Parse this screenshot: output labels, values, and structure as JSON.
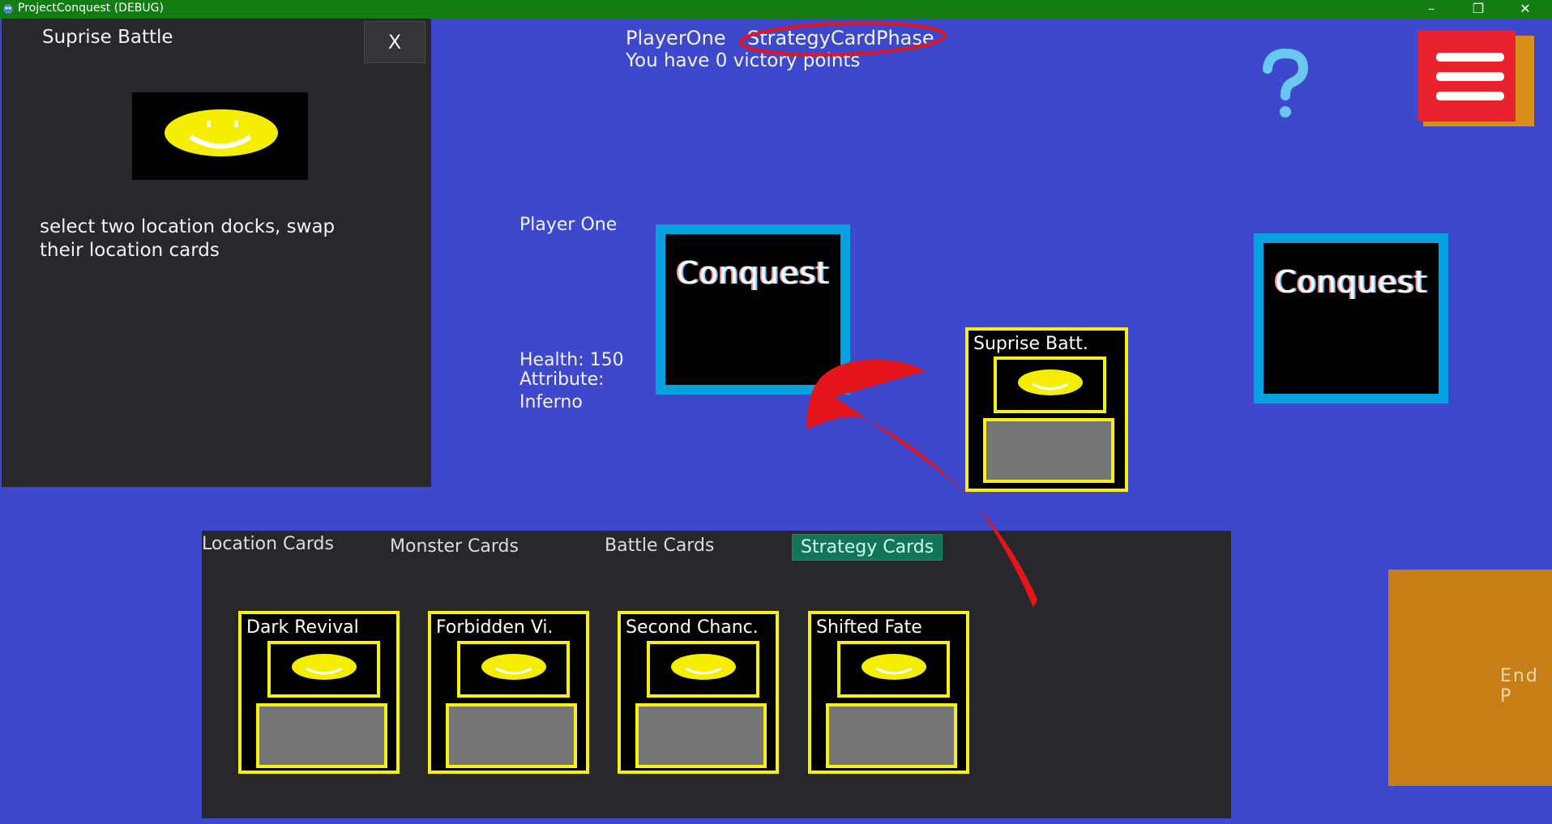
{
  "window": {
    "title": "ProjectConquest (DEBUG)",
    "app_icon": "godot-icon",
    "controls": [
      "minimize-icon",
      "restore-icon",
      "close-icon"
    ]
  },
  "popup": {
    "title": "Suprise Battle",
    "close_label": "X",
    "description": "select two location docks, swap their location cards"
  },
  "header": {
    "player_name": "PlayerOne",
    "phase": "StrategyCardPhase",
    "victory_points_text": "You have 0 victory points"
  },
  "player_info": {
    "label": "Player One",
    "health_line": "Health: 150",
    "attribute_line": "Attribute:",
    "attribute_value": "Inferno"
  },
  "locations": [
    {
      "title": "Conquest"
    },
    {
      "title": "Conquest"
    }
  ],
  "played_card": {
    "name": "Suprise Batt."
  },
  "hand": {
    "tabs": [
      "Location Cards",
      "Monster Cards",
      "Battle Cards",
      "Strategy Cards"
    ],
    "active_tab": "Strategy Cards",
    "cards": [
      {
        "name": "Dark Revival"
      },
      {
        "name": "Forbidden Vi."
      },
      {
        "name": "Second Chanc."
      },
      {
        "name": "Shifted Fate"
      }
    ]
  },
  "end_button": {
    "label": "End P"
  },
  "colors": {
    "background": "#3d48cd",
    "panel": "#28272c",
    "card_border": "#f7ee1a",
    "location_border": "#06a1e0",
    "menu_button": "#e8232d",
    "end_button": "#c87e16",
    "annotation": "#e5161b",
    "active_tab": "#127557"
  },
  "icons": {
    "help": "question-mark-icon",
    "menu": "hamburger-menu-icon",
    "card_art": "smiley-face-icon"
  }
}
